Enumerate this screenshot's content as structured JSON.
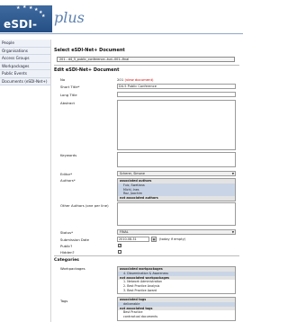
{
  "brand": {
    "logo_text": "eSDI-NET",
    "logo_suffix": "plus"
  },
  "sidebar": {
    "items": [
      {
        "label": "People"
      },
      {
        "label": "Organisations"
      },
      {
        "label": "Access Groups"
      },
      {
        "label": "Workpackages"
      },
      {
        "label": "Public Events"
      },
      {
        "label": "Documents (eSDI-Net+)"
      }
    ]
  },
  "select_section": {
    "title": "Select eSDI-Net+ Document",
    "selected": "201 - d4_5_public_conference--tud--001--final"
  },
  "edit_section": {
    "title": "Edit eSDI-Net+ Document",
    "fields": {
      "no_label": "No",
      "no_value": "201",
      "view_link": "(view document)",
      "short_title_label": "Short Title*",
      "short_title_value": "D4.5 Public Conference",
      "long_title_label": "Long Title",
      "abstract_label": "Abstract",
      "keywords_label": "Keywords",
      "editor_label": "Editor*",
      "editor_value": "Scherer, Simone",
      "authors_label": "Authors*",
      "authors_list": {
        "header_associated": "associated authors",
        "associated": [
          "Fuiz, Swetlana",
          "Michl, Ines",
          "Roz, Joachim"
        ],
        "header_not_associated": "not associated authors"
      },
      "other_authors_label": "Other Authors (one per line)",
      "status_label": "Status*",
      "status_value": "FINAL",
      "submission_date_label": "Submission Date",
      "submission_date_value": "2010-08-31",
      "today_hint": "(today if empty)",
      "public_label": "Public?",
      "hidden_label": "Hidden?"
    }
  },
  "categories": {
    "title": "Categories",
    "workpackages_label": "Workpackages",
    "workpackages_list": {
      "header_associated": "associated workpackages",
      "associated": [
        "4. Dissemination & Awareness"
      ],
      "header_not_associated": "not associated workpackages",
      "not_associated": [
        "1. Network Administration",
        "2. Best Practice Analysis",
        "3. Best Practice Award"
      ]
    },
    "tags_label": "Tags",
    "tags_list": {
      "header_associated": "associated tags",
      "associated": [
        "deliverable"
      ],
      "header_not_associated": "not associated tags",
      "not_associated": [
        "Best Practice",
        "contractual documents"
      ]
    }
  }
}
